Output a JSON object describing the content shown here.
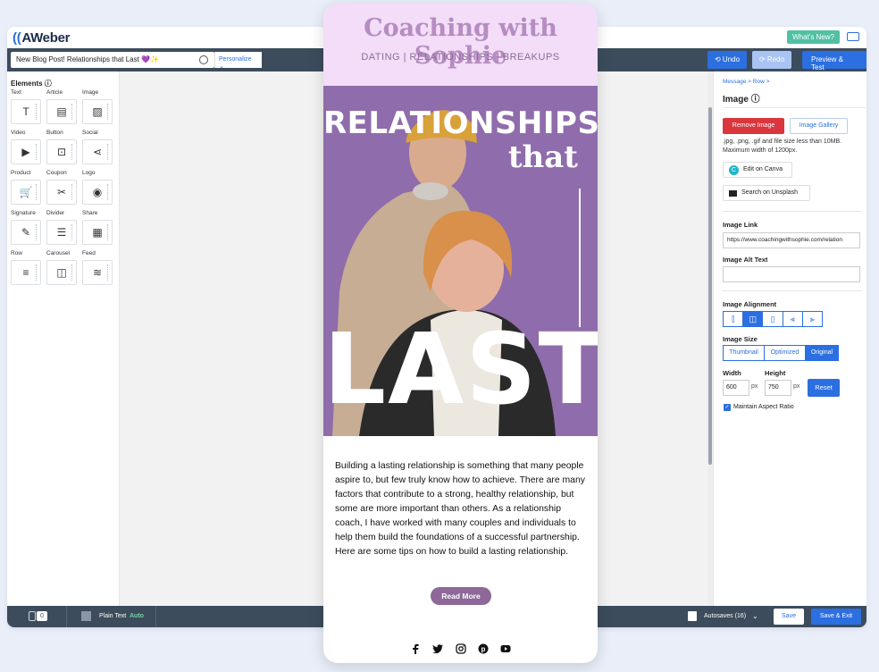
{
  "app": {
    "logo": "AWeber",
    "whats_new": "What's New?",
    "subject": "New Blog Post! Relationships that Last 💜✨",
    "personalize": "Personalize ⌄",
    "undo": "⟲ Undo",
    "redo": "⟳ Redo",
    "preview": "Preview & Test"
  },
  "elements_panel": {
    "title": "Elements ⓘ",
    "items": [
      {
        "label": "Text",
        "icon": "T"
      },
      {
        "label": "Article",
        "icon": "▤"
      },
      {
        "label": "Image",
        "icon": "▨"
      },
      {
        "label": "Video",
        "icon": "▶"
      },
      {
        "label": "Button",
        "icon": "⊡"
      },
      {
        "label": "Social",
        "icon": "⋖"
      },
      {
        "label": "Product",
        "icon": "🛒"
      },
      {
        "label": "Coupon",
        "icon": "✂"
      },
      {
        "label": "Logo",
        "icon": "◉"
      },
      {
        "label": "Signature",
        "icon": "✎"
      },
      {
        "label": "Divider",
        "icon": "☰"
      },
      {
        "label": "Share",
        "icon": "▦"
      },
      {
        "label": "Row",
        "icon": "≡"
      },
      {
        "label": "Carousel",
        "icon": "◫"
      },
      {
        "label": "Feed",
        "icon": "≋"
      }
    ]
  },
  "right_panel": {
    "breadcrumb": "Message  >  Row  >",
    "title": "Image ⓘ",
    "remove_image": "Remove Image",
    "image_gallery": "Image Gallery",
    "file_note": ".jpg, .png, .gif and file size less than 10MB. Maximum width of 1200px.",
    "edit_canva": "Edit on Canva",
    "search_unsplash": "Search on Unsplash",
    "image_link_label": "Image Link",
    "image_link_value": "https://www.coachingwithsophie.com/relation",
    "alt_text_label": "Image Alt Text",
    "alt_text_value": "",
    "alignment_label": "Image Alignment",
    "size_label": "Image Size",
    "size_options": [
      "Thumbnail",
      "Optimized",
      "Original"
    ],
    "width_label": "Width",
    "height_label": "Height",
    "width_value": "600",
    "height_value": "750",
    "unit": "px",
    "reset": "Reset",
    "aspect_ratio": "Maintain Aspect Ratio"
  },
  "bottom_bar": {
    "count": "0",
    "plain_text": "Plain Text",
    "auto": "Auto",
    "autosaves": "Autosaves (16)",
    "save": "Save",
    "save_exit": "Save & Exit"
  },
  "email": {
    "title": "Coaching with Sophie",
    "subtitle": "DATING | RELATIONSHIPS | BREAKUPS",
    "hero_line1": "RELATIONSHIPS",
    "hero_line2": "that",
    "hero_line3": "LAST",
    "body": "Building a lasting relationship is something that many people aspire to, but few truly know how to achieve. There are many factors that contribute to a strong, healthy relationship, but some are more important than others. As a relationship coach, I have worked with many couples and individuals to help them build the foundations of a successful partnership. Here are some tips on how to build a lasting relationship.",
    "read_more": "Read More"
  },
  "colors": {
    "accent": "#2b6fe0",
    "toolbar": "#3c4c5c",
    "header_bg": "#f3ddf8",
    "brand_purple": "#8d6898",
    "remove": "#d9363e"
  }
}
